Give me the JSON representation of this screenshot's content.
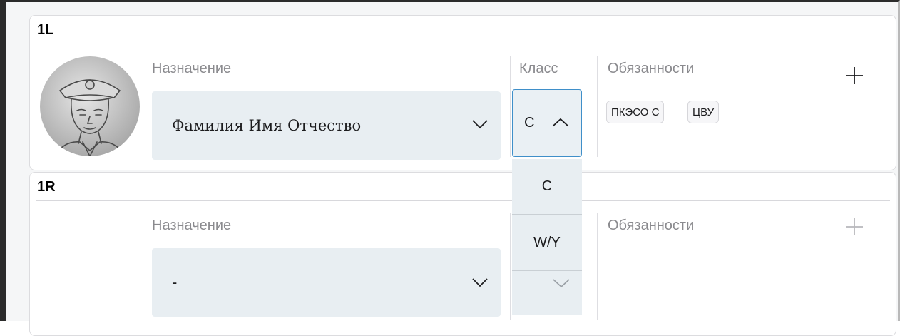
{
  "roles": [
    {
      "position": "1L",
      "assignment_label": "Назначение",
      "assignment_value": "Фамилия Имя Отчество",
      "class_label": "Класс",
      "class_value": "C",
      "duties_label": "Обязанности",
      "duties": [
        "ПКЭСО С",
        "ЦВУ"
      ]
    },
    {
      "position": "1R",
      "assignment_label": "Назначение",
      "assignment_value": "-",
      "duties_label": "Обязанности",
      "duties": []
    }
  ],
  "class_dropdown": {
    "options": [
      "C",
      "W/Y"
    ]
  },
  "icons": {
    "add": "plus-icon",
    "expand": "chevron-down-icon",
    "collapse": "chevron-up-icon",
    "avatar": "officer-portrait"
  },
  "colors": {
    "select_bg": "#e8eef2",
    "focus_border": "#3f8fc9",
    "label_text": "#8a8a8e"
  }
}
